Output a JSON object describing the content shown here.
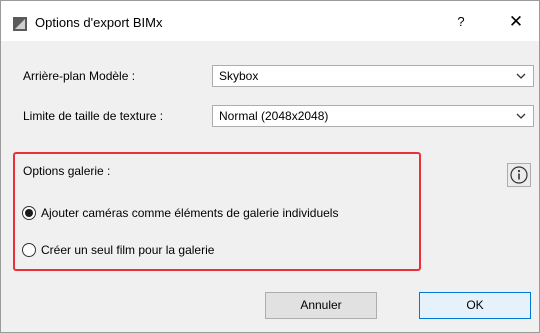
{
  "window": {
    "title": "Options d'export BIMx",
    "help_label": "?",
    "close_label": "✕"
  },
  "form": {
    "background_label": "Arrière-plan Modèle :",
    "background_value": "Skybox",
    "texture_label": "Limite de taille de texture :",
    "texture_value": "Normal (2048x2048)"
  },
  "gallery": {
    "title": "Options galerie :",
    "options": [
      {
        "label": "Ajouter caméras comme éléments de galerie individuels",
        "checked": true
      },
      {
        "label": "Créer un seul film pour la galerie",
        "checked": false
      }
    ],
    "highlight_color": "#e8323a"
  },
  "buttons": {
    "cancel": "Annuler",
    "ok": "OK"
  },
  "icons": {
    "app": "bimx-app-icon",
    "info": "info-icon",
    "dropdown": "chevron-down-icon"
  }
}
